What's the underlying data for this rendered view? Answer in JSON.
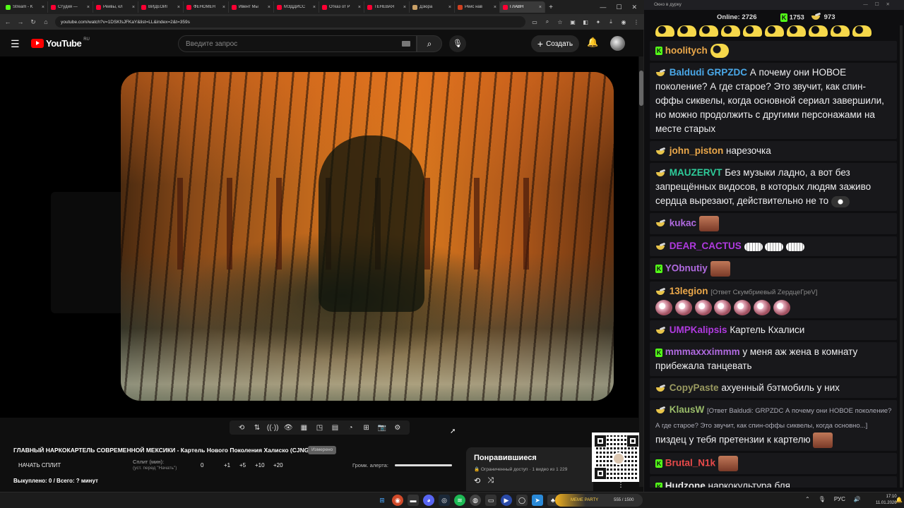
{
  "browser": {
    "tabs": [
      {
        "title": "Stream - K",
        "color": "#53fc18",
        "active": false
      },
      {
        "title": "Студия —",
        "color": "#ff0033",
        "active": false
      },
      {
        "title": "Рейвы, кл",
        "color": "#ff0033",
        "active": false
      },
      {
        "title": "ВИДЕОИГ",
        "color": "#ff0033",
        "active": false
      },
      {
        "title": "ФЕНОМЕН",
        "color": "#ff0033",
        "active": false
      },
      {
        "title": "Ивент Мы",
        "color": "#ff0033",
        "active": false
      },
      {
        "title": "МЭДДИСС",
        "color": "#ff0033",
        "active": false
      },
      {
        "title": "Отказ от Р",
        "color": "#ff0033",
        "active": false
      },
      {
        "title": "ТЕНЕВАЯ",
        "color": "#ff0033",
        "active": false
      },
      {
        "title": "Дзюра",
        "color": "#c9a066",
        "active": false
      },
      {
        "title": "Рейс нав",
        "color": "#d04020",
        "active": false
      },
      {
        "title": "ГЛАВН",
        "color": "#ff0033",
        "active": true
      }
    ],
    "url": "youtube.com/watch?v=1DSKfsJFKaY&list=LL&index=2&t=359s",
    "window_controls": [
      "—",
      "☐",
      "✕"
    ]
  },
  "youtube": {
    "logo_text": "YouTube",
    "region": "RU",
    "search_placeholder": "Введите запрос",
    "create_label": "Создать"
  },
  "player": {
    "controls": [
      "loop-icon",
      "sort-icon",
      "broadcast-icon",
      "eye-icon",
      "film-icon",
      "pip-icon",
      "frames-icon",
      "speed-icon",
      "add-frame-icon",
      "camera-icon",
      "settings-icon"
    ]
  },
  "video": {
    "title": "ГЛАВНЫЙ НАРКОКАРТЕЛЬ СОВРЕМЕННОЙ МЕКСИКИ - Картель Нового Поколения Халиско (CJNG)",
    "badge": "Измерено",
    "split_button": "НАЧАТЬ СПЛИТ",
    "split_label": "Сплит (мин):",
    "split_sub": "(уст. перед \"Начать\")",
    "split_value": "0",
    "split_increments": [
      "+1",
      "+5",
      "+10",
      "+20"
    ],
    "alert_label": "Громк. алерта:",
    "alert_volume": 1.0,
    "bought": "Выкуплено: 0 / Всего: ? минут"
  },
  "liked_panel": {
    "title": "Понравившиеся",
    "subtitle": "🔒 Ограниченный доступ  ·  1 видео из 1 229"
  },
  "chat": {
    "window_title": "Окно в дурку",
    "online": "Online: 2726",
    "kick_count": "1753",
    "bowl_count": "973",
    "messages": [
      {
        "badge": "kick",
        "name": "hoolitych",
        "color": "#eba84a",
        "text": "",
        "emote": "moon1"
      },
      {
        "badge": "bowl",
        "name": "Baldudi",
        "color": "#4aa8e8",
        "name2": "GRPZDC",
        "text": "А почему они НОВОЕ поколение? А где старое? Это звучит, как спин-оффы сиквелы, когда основной сериал завершили, но можно продолжить с другими персонажами на месте старых"
      },
      {
        "badge": "bowl",
        "name": "john_piston",
        "color": "#eba84a",
        "text": "нарезочка"
      },
      {
        "badge": "bowl",
        "name": "MAUZERVT",
        "color": "#2ecc9a",
        "text": "Без музыки ладно, а вот без запрещённых видосов, в которых людям заживо сердца вырезают, действительно не то",
        "emote": "blob"
      },
      {
        "badge": "bowl",
        "name": "kukac",
        "color": "#b06ae0",
        "text": "",
        "emote": "face"
      },
      {
        "badge": "bowl",
        "name": "DEAR_CACTUS",
        "color": "#b03ae0",
        "text": "",
        "emote": "teeth"
      },
      {
        "badge": "kick",
        "name": "YObnutiy",
        "color": "#b06ae0",
        "text": "",
        "emote": "face"
      },
      {
        "badge": "bowl",
        "name": "13legion",
        "color": "#eba84a",
        "reply": "[Ответ Скумбриевый ZердцеГреV]",
        "text": "",
        "emote": "ball"
      },
      {
        "badge": "bowl",
        "name": "UMPKalipsis",
        "color": "#b03ae0",
        "text": "Картель Кхалиси"
      },
      {
        "badge": "kick",
        "name": "mmmaxxximmm",
        "color": "#b06ae0",
        "text": "у меня аж жена в комнату прибежала танцевать"
      },
      {
        "badge": "bowl",
        "name": "CopyPaste",
        "color": "#9a9a60",
        "text": "ахуенный бэтмобиль у них"
      },
      {
        "badge": "bowl",
        "name": "KlausW",
        "color": "#9abc6a",
        "reply": "[Ответ Baldudi: GRPZDC А почему они НОВОЕ поколение? А где старое? Это звучит, как спин-оффы сиквелы, когда основно...]",
        "text": "пиздец у тебя претензии к картелю",
        "emote": "face"
      },
      {
        "badge": "kick",
        "name": "Brutal_N1k",
        "color": "#e84a4a",
        "text": "",
        "emote": "face"
      },
      {
        "badge": "kick",
        "name": "Hudzone",
        "color": "#e8e8e8",
        "text": "наркокультура бля"
      }
    ]
  },
  "taskbar": {
    "icons": [
      "windows-icon",
      "search-icon",
      "chrome-icon",
      "discord-icon",
      "explorer-icon",
      "steam-icon",
      "spotify-icon",
      "obs-icon",
      "app-icon",
      "media-icon",
      "telegram-icon",
      "vscode-icon"
    ],
    "meme_party_label": "MEME PARTY",
    "meme_party_count": "555 / 1500",
    "lang": "РУС",
    "time": "17:10",
    "date": "11.01.2026"
  },
  "colors": {
    "kick_green": "#53fc18",
    "yt_red": "#ff0000",
    "chat_bg": "#0e0e10",
    "msg_bg": "#18181b"
  }
}
